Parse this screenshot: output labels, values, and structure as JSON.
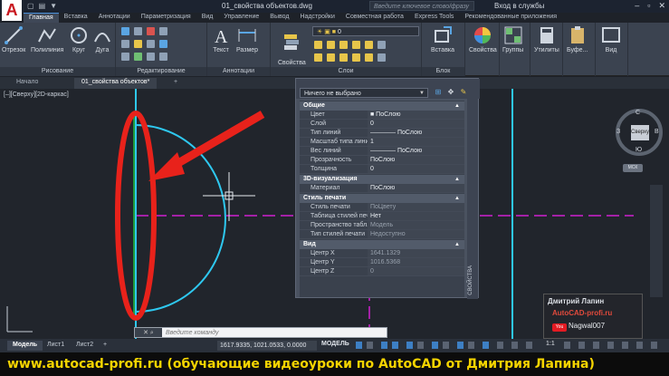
{
  "titlebar": {
    "app_logo": "A",
    "doc_title": "01_свойства объектов.dwg",
    "search_placeholder": "Введите ключевое слово/фразу",
    "login": "Вход в службы",
    "qat": [
      "▢",
      "▤",
      "▼"
    ]
  },
  "ribbon_tabs": [
    "Главная",
    "Вставка",
    "Аннотации",
    "Параметризация",
    "Вид",
    "Управление",
    "Вывод",
    "Надстройки",
    "Совместная работа",
    "Express Tools",
    "Рекомендованные приложения"
  ],
  "ribbon_panels": {
    "drawing": {
      "title": "Рисование",
      "tools": [
        "Отрезок",
        "Полилиния",
        "Круг",
        "Дуга"
      ]
    },
    "modify": {
      "title": "Редактирование"
    },
    "annotations": {
      "title": "Аннотации",
      "tools": [
        "Текст",
        "Размер"
      ]
    },
    "layers": {
      "title": "Слои",
      "props_label": "Свойства\nслоя",
      "current_layer": "0"
    },
    "block": {
      "title": "Блок",
      "tools": [
        "Вставка"
      ]
    },
    "right_tools": [
      "Свойства",
      "Группы",
      "Утилиты",
      "Буфе...",
      "Вид"
    ]
  },
  "file_tabs": [
    "Начало",
    "01_свойства объектов*",
    "+"
  ],
  "viewport": {
    "label": "[–][Сверху][2D-каркас]"
  },
  "properties": {
    "selection": "Ничего не выбрано",
    "side_label": "СВОЙСТВА",
    "sections": [
      {
        "title": "Общие",
        "rows": [
          {
            "k": "Цвет",
            "v": "■ ПоСлою"
          },
          {
            "k": "Слой",
            "v": "0"
          },
          {
            "k": "Тип линий",
            "v": "———— ПоСлою"
          },
          {
            "k": "Масштаб типа линий",
            "v": "1"
          },
          {
            "k": "Вес линий",
            "v": "———— ПоСлою"
          },
          {
            "k": "Прозрачность",
            "v": "ПоСлою"
          },
          {
            "k": "Толщина",
            "v": "0"
          }
        ]
      },
      {
        "title": "3D-визуализация",
        "rows": [
          {
            "k": "Материал",
            "v": "ПоСлою"
          }
        ]
      },
      {
        "title": "Стиль печати",
        "rows": [
          {
            "k": "Стиль печати",
            "v": "ПоЦвету"
          },
          {
            "k": "Таблица стилей печ...",
            "v": "Нет"
          },
          {
            "k": "Пространство табл...",
            "v": "Модель"
          },
          {
            "k": "Тип стилей печати",
            "v": "Недоступно"
          }
        ]
      },
      {
        "title": "Вид",
        "rows": [
          {
            "k": "Центр X",
            "v": "1641.1329"
          },
          {
            "k": "Центр Y",
            "v": "1016.5368"
          },
          {
            "k": "Центр Z",
            "v": "0"
          }
        ]
      }
    ]
  },
  "viewcube": {
    "face": "Сверху",
    "north": "С",
    "south": "Ю",
    "west": "З",
    "east": "В",
    "wcs": "МСК"
  },
  "command": {
    "placeholder": "Введите команду"
  },
  "watermark": {
    "name": "Дмитрий Лапин",
    "site": "AutoCAD-profi.ru",
    "yt_logo": "You",
    "yt": "Nagwal007"
  },
  "statusbar": {
    "layouts": [
      "Модель",
      "Лист1",
      "Лист2",
      "+"
    ],
    "coords": "1617.9335, 1021.0533, 0.0000",
    "model": "МОДЕЛЬ",
    "scale": "1:1"
  },
  "banner": "www.autocad-profi.ru  (обучающие видеоуроки по AutoCAD от Дмитрия Лапина)",
  "colors": {
    "accent": "#4a90d9",
    "annotation_red": "#e8221b",
    "cyan_geometry": "#2ec8f0",
    "magenta_axis": "#d020d0"
  }
}
